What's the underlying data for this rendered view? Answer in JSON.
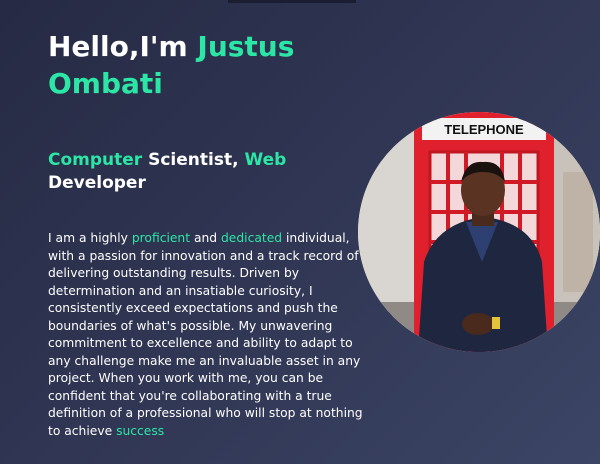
{
  "hero": {
    "greeting": "Hello,I'm ",
    "name_first": "Justus",
    "name_last": "Ombati"
  },
  "subtitle": {
    "part1_accent": "Computer",
    "part2": " Scientist, ",
    "part3_accent": "Web",
    "part4": " Developer"
  },
  "bio": {
    "t1": "I am a highly ",
    "a1": "proficient",
    "t2": " and ",
    "a2": "dedicated",
    "t3": " individual, with a passion for innovation and a track record of delivering outstanding results. Driven by determination and an insatiable curiosity, I consistently exceed expectations and push the boundaries of what's possible. My unwavering commitment to excellence and ability to adapt to any challenge make me an invaluable asset in any project. When you work with me, you can be confident that you're collaborating with a true definition of a professional who will stop at nothing to achieve ",
    "a3": "success"
  },
  "portrait": {
    "booth_sign": "TELEPHONE"
  },
  "colors": {
    "accent": "#2ce6a6",
    "text": "#ffffff",
    "bg_start": "#262a44",
    "bg_end": "#3c4566",
    "booth_red": "#e0202c"
  }
}
